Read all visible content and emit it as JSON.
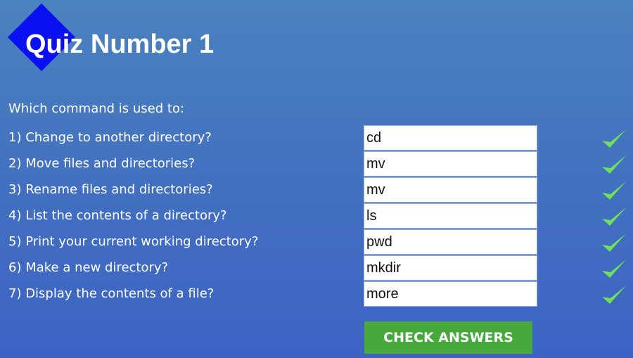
{
  "header": {
    "title": "Quiz Number 1"
  },
  "quiz": {
    "intro": "Which command is used to:",
    "questions": [
      {
        "label": "1) Change to another directory?",
        "answer": "cd",
        "correct": true
      },
      {
        "label": "2) Move files and directories?",
        "answer": "mv",
        "correct": true
      },
      {
        "label": "3) Rename files and directories?",
        "answer": "mv",
        "correct": true
      },
      {
        "label": "4) List the contents of a directory?",
        "answer": "ls",
        "correct": true
      },
      {
        "label": "5) Print your current working directory?",
        "answer": "pwd",
        "correct": true
      },
      {
        "label": "6) Make a new directory?",
        "answer": "mkdir",
        "correct": true
      },
      {
        "label": "7) Display the contents of a file?",
        "answer": "more",
        "correct": true
      }
    ],
    "check_button_label": "CHECK ANSWERS"
  },
  "colors": {
    "diamond": "#0a10ef",
    "button": "#47a83e",
    "checkmark": "#6fe05a"
  },
  "icons": {
    "correct": "checkmark-icon",
    "logo": "diamond-icon"
  }
}
